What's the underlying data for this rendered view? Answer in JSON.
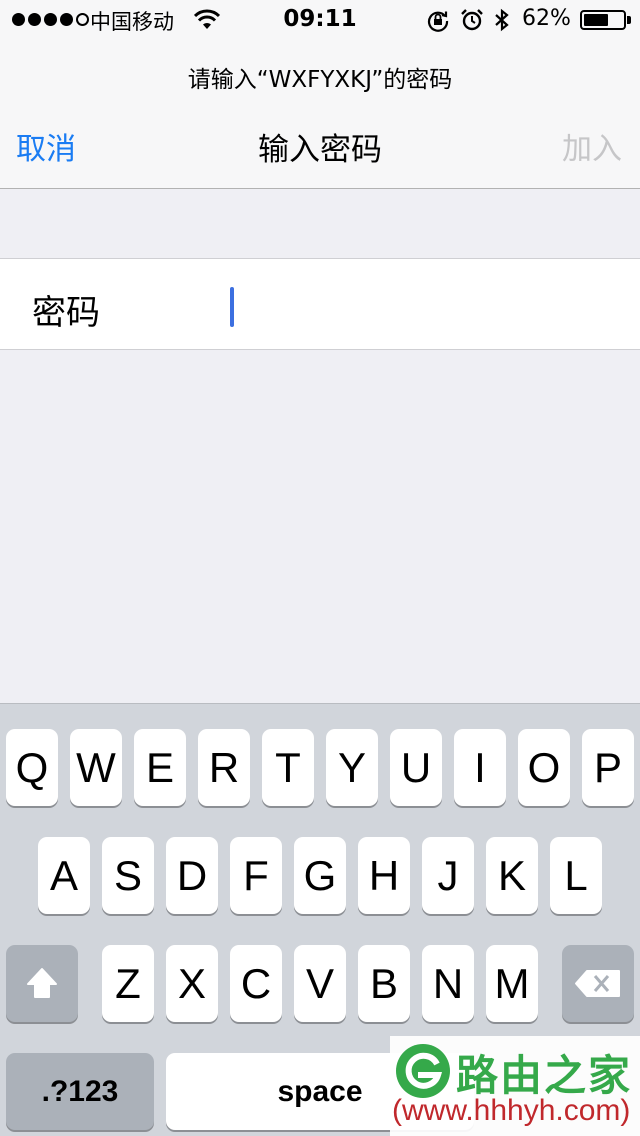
{
  "status_bar": {
    "carrier": "中国移动",
    "time": "09:11",
    "battery_percent": "62%",
    "battery_level": 0.62,
    "icons": [
      "signal-dots-icon",
      "wifi-icon",
      "rotation-lock-icon",
      "alarm-icon",
      "bluetooth-icon",
      "battery-icon"
    ]
  },
  "header": {
    "prompt": "请输入“WXFYXKJ”的密码",
    "cancel_label": "取消",
    "title": "输入密码",
    "join_label": "加入"
  },
  "form": {
    "password_label": "密码",
    "password_value": ""
  },
  "keyboard": {
    "row1": [
      "Q",
      "W",
      "E",
      "R",
      "T",
      "Y",
      "U",
      "I",
      "O",
      "P"
    ],
    "row2": [
      "A",
      "S",
      "D",
      "F",
      "G",
      "H",
      "J",
      "K",
      "L"
    ],
    "row3": [
      "Z",
      "X",
      "C",
      "V",
      "B",
      "N",
      "M"
    ],
    "numbers_label": ".?123",
    "space_label": "space",
    "shift_icon": "shift-arrow-icon",
    "delete_icon": "backspace-icon"
  },
  "watermark": {
    "title": "路由之家",
    "url": "(www.hhhyh.com)"
  },
  "colors": {
    "accent": "#1a7cf3",
    "disabled": "#c6c6c8",
    "caret": "#3c6fe0",
    "keyboard_bg": "#d1d5db",
    "watermark_green": "#35a94a",
    "watermark_red": "#c0282c"
  }
}
